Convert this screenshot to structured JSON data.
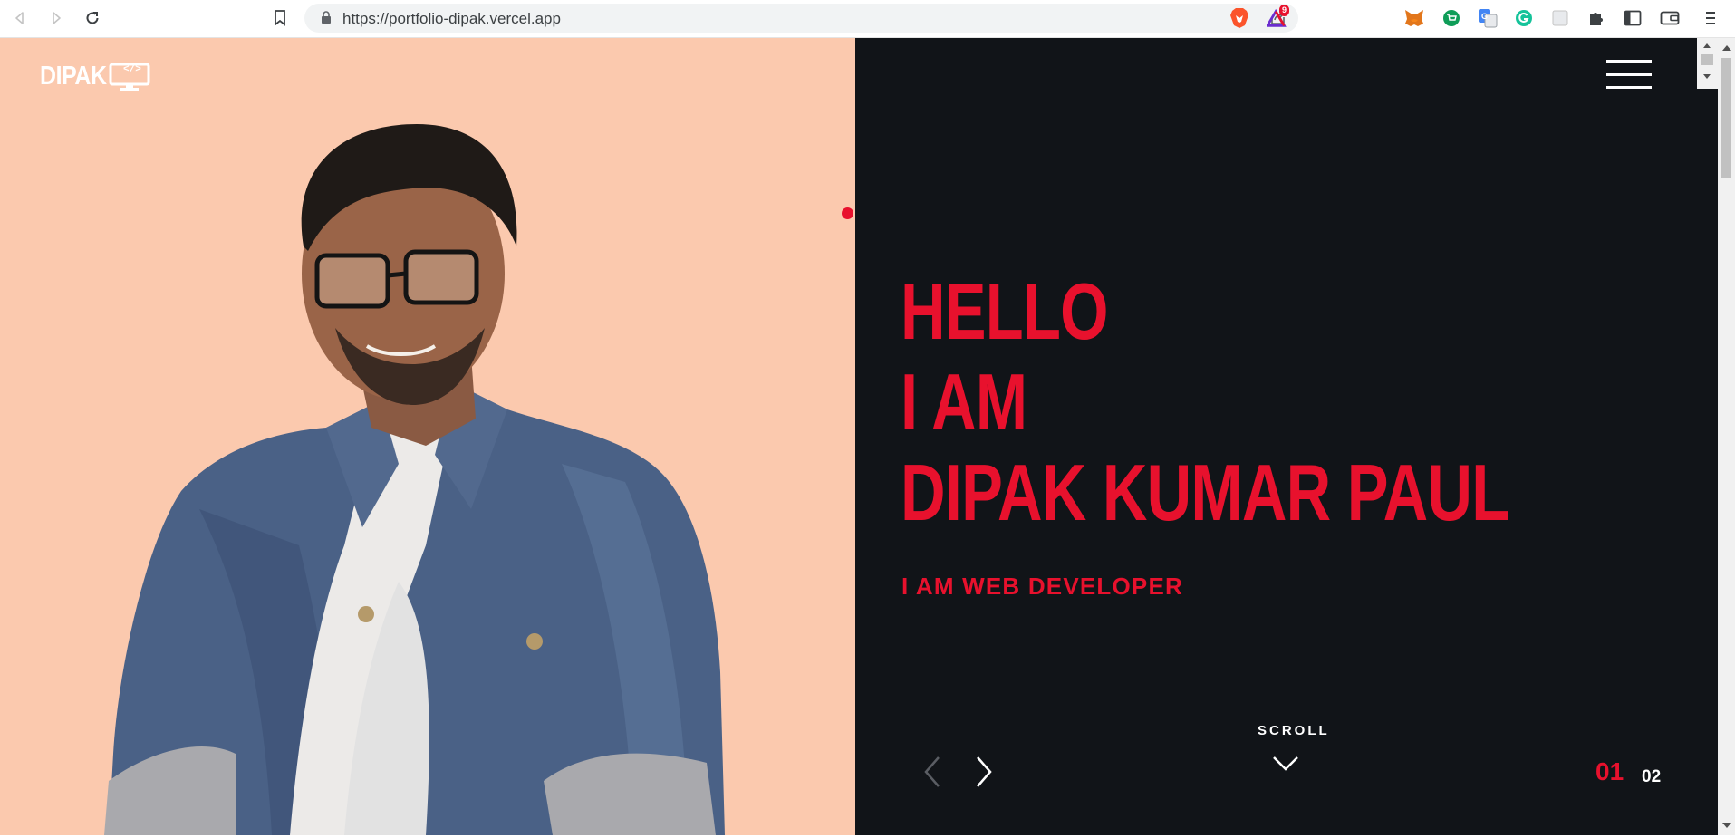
{
  "browser": {
    "url": "https://portfolio-dipak.vercel.app",
    "extensions": [
      "metamask-fox-icon",
      "shopping-cart-icon",
      "google-translate-icon",
      "grammarly-icon",
      "extension-placeholder-icon",
      "puzzle-icon",
      "sidebar-icon",
      "wallet-icon",
      "more-vertical-icon"
    ],
    "brave_badge": "9"
  },
  "site": {
    "logo_text": "DIPAK",
    "logo_code_glyph": "</>",
    "headline": {
      "line1": "HELLO",
      "line2": "I AM",
      "line3": "DIPAK KUMAR PAUL"
    },
    "subtitle": "I AM WEB DEVELOPER",
    "scroll_label": "SCROLL",
    "slides": {
      "current": "01",
      "next": "02"
    },
    "colors": {
      "accent": "#e8112d",
      "left_bg": "#fbc9ae",
      "right_bg": "#111418"
    }
  }
}
